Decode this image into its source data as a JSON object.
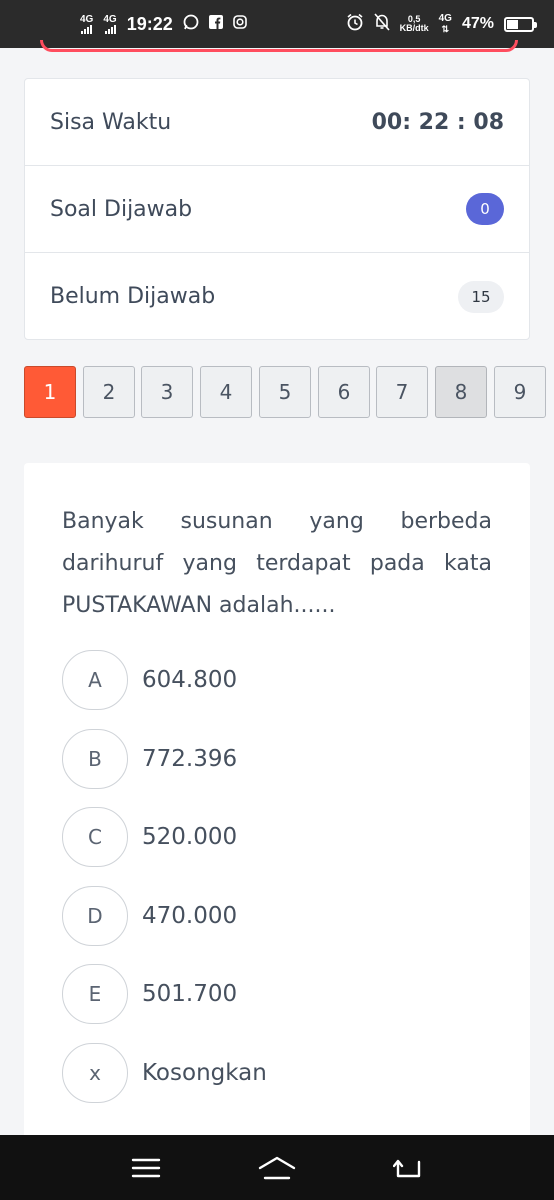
{
  "status_bar": {
    "net1": "4G",
    "net2": "4G",
    "time": "19:22",
    "speed_value": "0,5",
    "speed_unit": "KB/dtk",
    "net3": "4G",
    "battery_pct": "47%",
    "battery_level": 0.47,
    "icons": [
      "whatsapp-icon",
      "facebook-icon",
      "instagram-icon",
      "alarm-icon",
      "mute-bell-icon",
      "battery-icon"
    ]
  },
  "info": {
    "time_label": "Sisa Waktu",
    "time_value": "00: 22 : 08",
    "answered_label": "Soal Dijawab",
    "answered_count": "0",
    "unanswered_label": "Belum Dijawab",
    "unanswered_count": "15"
  },
  "question_numbers": [
    "1",
    "2",
    "3",
    "4",
    "5",
    "6",
    "7",
    "8",
    "9"
  ],
  "active_question": "1",
  "flagged_question": "8",
  "question": {
    "text": "Banyak susunan yang berbeda darihuruf yang terdapat pada kata PUSTAKAWAN adalah......",
    "options": [
      {
        "key": "A",
        "text": "604.800"
      },
      {
        "key": "B",
        "text": "772.396"
      },
      {
        "key": "C",
        "text": "520.000"
      },
      {
        "key": "D",
        "text": "470.000"
      },
      {
        "key": "E",
        "text": "501.700"
      },
      {
        "key": "x",
        "text": "Kosongkan"
      }
    ]
  },
  "colors": {
    "active": "#ff5a36",
    "badge_primary": "#5a67d8",
    "accent_red": "#ff4d5e"
  }
}
